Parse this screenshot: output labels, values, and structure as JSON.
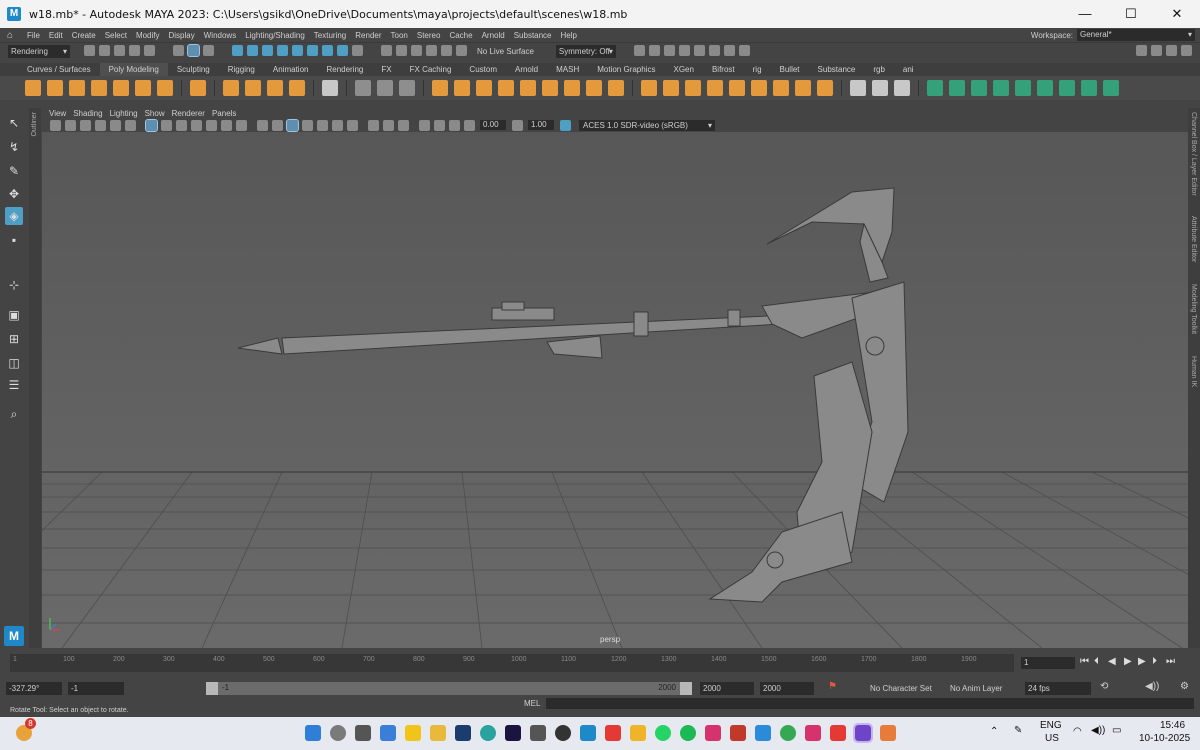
{
  "window": {
    "title": "w18.mb* - Autodesk MAYA 2023: C:\\Users\\gsikd\\OneDrive\\Documents\\maya\\projects\\default\\scenes\\w18.mb",
    "app_logo": "M",
    "minimize": "—",
    "maximize": "☐",
    "close": "✕"
  },
  "menubar": {
    "items": [
      "File",
      "Edit",
      "Create",
      "Select",
      "Modify",
      "Display",
      "Windows",
      "Lighting/Shading",
      "Texturing",
      "Render",
      "Toon",
      "Stereo",
      "Cache",
      "Arnold",
      "Substance",
      "Help"
    ],
    "workspace_label": "Workspace:",
    "workspace_value": "General*"
  },
  "statusline": {
    "menuset": "Rendering",
    "live_surface": "No Live Surface",
    "symmetry": "Symmetry: Off"
  },
  "shelf_tabs": {
    "items": [
      "Curves / Surfaces",
      "Poly Modeling",
      "Sculpting",
      "Rigging",
      "Animation",
      "Rendering",
      "FX",
      "FX Caching",
      "Custom",
      "Arnold",
      "MASH",
      "Motion Graphics",
      "XGen",
      "Bifrost",
      "rig",
      "Bullet",
      "Substance",
      "rgb",
      "ani"
    ],
    "active_index": 1
  },
  "left_strip": {
    "outliner": "Outliner"
  },
  "right_strip": {
    "items": [
      "Channel Box / Layer Editor",
      "Attribute Editor",
      "Modeling Toolkit",
      "Human IK"
    ]
  },
  "panel": {
    "menus": [
      "View",
      "Shading",
      "Lighting",
      "Show",
      "Renderer",
      "Panels"
    ],
    "exposure": "0.00",
    "gamma": "1.00",
    "color_space": "ACES 1.0 SDR-video (sRGB)",
    "camera": "persp"
  },
  "timeline": {
    "start_tick": "1",
    "ticks": [
      "100",
      "200",
      "300",
      "400",
      "500",
      "600",
      "700",
      "800",
      "900",
      "1000",
      "1100",
      "1200",
      "1300",
      "1400",
      "1500",
      "1600",
      "1700",
      "1800",
      "1900"
    ],
    "current_frame": "1"
  },
  "range": {
    "rotate_value": "-327.29°",
    "start": "-1",
    "slider_start": "-1",
    "slider_end": "2000",
    "anim_end": "2000",
    "playback_end": "2000",
    "character_set": "No Character Set",
    "anim_layer": "No Anim Layer",
    "fps": "24 fps"
  },
  "cmdline": {
    "help": "Rotate Tool: Select an object to rotate.",
    "lang": "MEL"
  },
  "taskbar": {
    "badge": "8",
    "lang": "ENG",
    "region": "US",
    "time": "15:46",
    "date": "10-10-2025"
  },
  "colors": {
    "accent": "#4f9ec4",
    "maya_blue": "#1e88c8",
    "shelf_orange": "#e49a3c",
    "shelf_green": "#35a17a",
    "viewport": "#5d5d5d"
  }
}
